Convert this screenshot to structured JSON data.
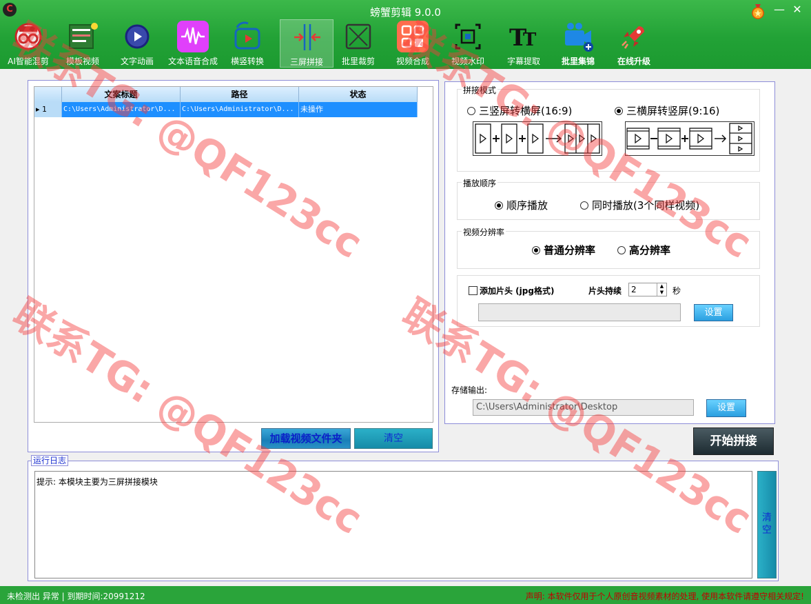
{
  "window": {
    "title": "螃蟹剪辑 9.0.0",
    "logo_text": "C",
    "minimize": "—",
    "close": "✕"
  },
  "toolbar": [
    {
      "label": "AI智能混剪",
      "icon": "ai-mix-icon"
    },
    {
      "label": "模板视频",
      "icon": "template-icon"
    },
    {
      "label": "文字动画",
      "icon": "text-animation-icon"
    },
    {
      "label": "文本语音合成",
      "icon": "tts-icon"
    },
    {
      "label": "横竖转换",
      "icon": "rotate-icon"
    },
    {
      "label": "三屏拼接",
      "icon": "split-screen-icon",
      "active": true
    },
    {
      "label": "批里裁剪",
      "icon": "crop-icon"
    },
    {
      "label": "视频合成",
      "icon": "video-merge-icon"
    },
    {
      "label": "视频水印",
      "icon": "watermark-icon"
    },
    {
      "label": "字幕提取",
      "icon": "subtitle-icon"
    },
    {
      "label": "批里集锦",
      "icon": "highlights-icon",
      "bold": true
    },
    {
      "label": "在线升级",
      "icon": "rocket-icon",
      "bold": true
    }
  ],
  "grid": {
    "columns": [
      "文案标题",
      "路径",
      "状态"
    ],
    "rows": [
      {
        "index": "1",
        "title": "C:\\Users\\Administrator\\D...",
        "path": "C:\\Users\\Administrator\\D...",
        "status": "未操作"
      }
    ]
  },
  "left_buttons": {
    "load": "加载视频文件夹",
    "clear": "清空"
  },
  "splice_mode": {
    "title": "拼接模式",
    "option1": "三竖屏转横屏(16:9)",
    "option2": "三横屏转竖屏(9:16)",
    "selected": "option2"
  },
  "play_order": {
    "title": "播放顺序",
    "option1": "顺序播放",
    "option2": "同时播放(3个同样视频)",
    "selected": "option1"
  },
  "resolution": {
    "title": "视频分辨率",
    "option1": "普通分辨率",
    "option2": "高分辨率",
    "selected": "option1"
  },
  "intro": {
    "checkbox_label": "添加片头 (jpg格式)",
    "duration_label": "片头持续",
    "duration_value": "2",
    "unit": "秒",
    "path_value": "",
    "set_button": "设置"
  },
  "output": {
    "label": "存储输出:",
    "path": "C:\\Users\\Administrator\\Desktop",
    "set_button": "设置"
  },
  "start_button": "开始拼接",
  "log": {
    "title": "运行日志",
    "text": "提示: 本模块主要为三屏拼接模块",
    "clear_button": "清空"
  },
  "status": {
    "left": "未检测出 异常 | 到期时间:20991212",
    "right": "声明: 本软件仅用于个人原创音视频素材的处理, 使用本软件请遵守相关规定!"
  },
  "watermark_text": "联系TG: @QF123cc",
  "colors": {
    "title_green": "#22a236",
    "selection_blue": "#1e8fff",
    "watermark_red": "#f53c3c"
  }
}
